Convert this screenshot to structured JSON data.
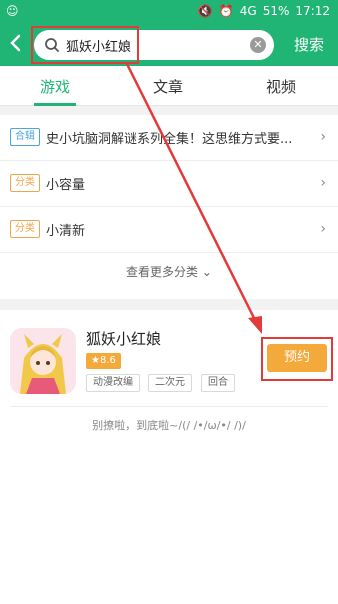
{
  "status_bar": {
    "battery": "51%",
    "time": "17:12",
    "signal_small": "4G"
  },
  "header": {
    "back_label": "<",
    "search_query": "狐妖小红娘",
    "search_button": "搜索"
  },
  "tabs": [
    {
      "label": "游戏",
      "active": true
    },
    {
      "label": "文章",
      "active": false
    },
    {
      "label": "视频",
      "active": false
    }
  ],
  "categories": [
    {
      "badge": "合辑",
      "badge_color": "#4aa5e0",
      "text": "史小坑脑洞解谜系列全集！这思维方式要..."
    },
    {
      "badge": "分类",
      "badge_color": "#f0a64b",
      "text": "小容量"
    },
    {
      "badge": "分类",
      "badge_color": "#f0a64b",
      "text": "小清新"
    }
  ],
  "more_categories": "查看更多分类",
  "game": {
    "title": "狐妖小红娘",
    "rating": "8.6",
    "tags": [
      "动漫改编",
      "二次元",
      "回合"
    ],
    "action_button": "预约"
  },
  "footer_text": "别撩啦，到底啦~/(/ /•/ω/•/ /)/",
  "colors": {
    "brand_green": "#20b575",
    "accent_orange": "#f4a93b",
    "annotation_red": "#e33a3a"
  }
}
